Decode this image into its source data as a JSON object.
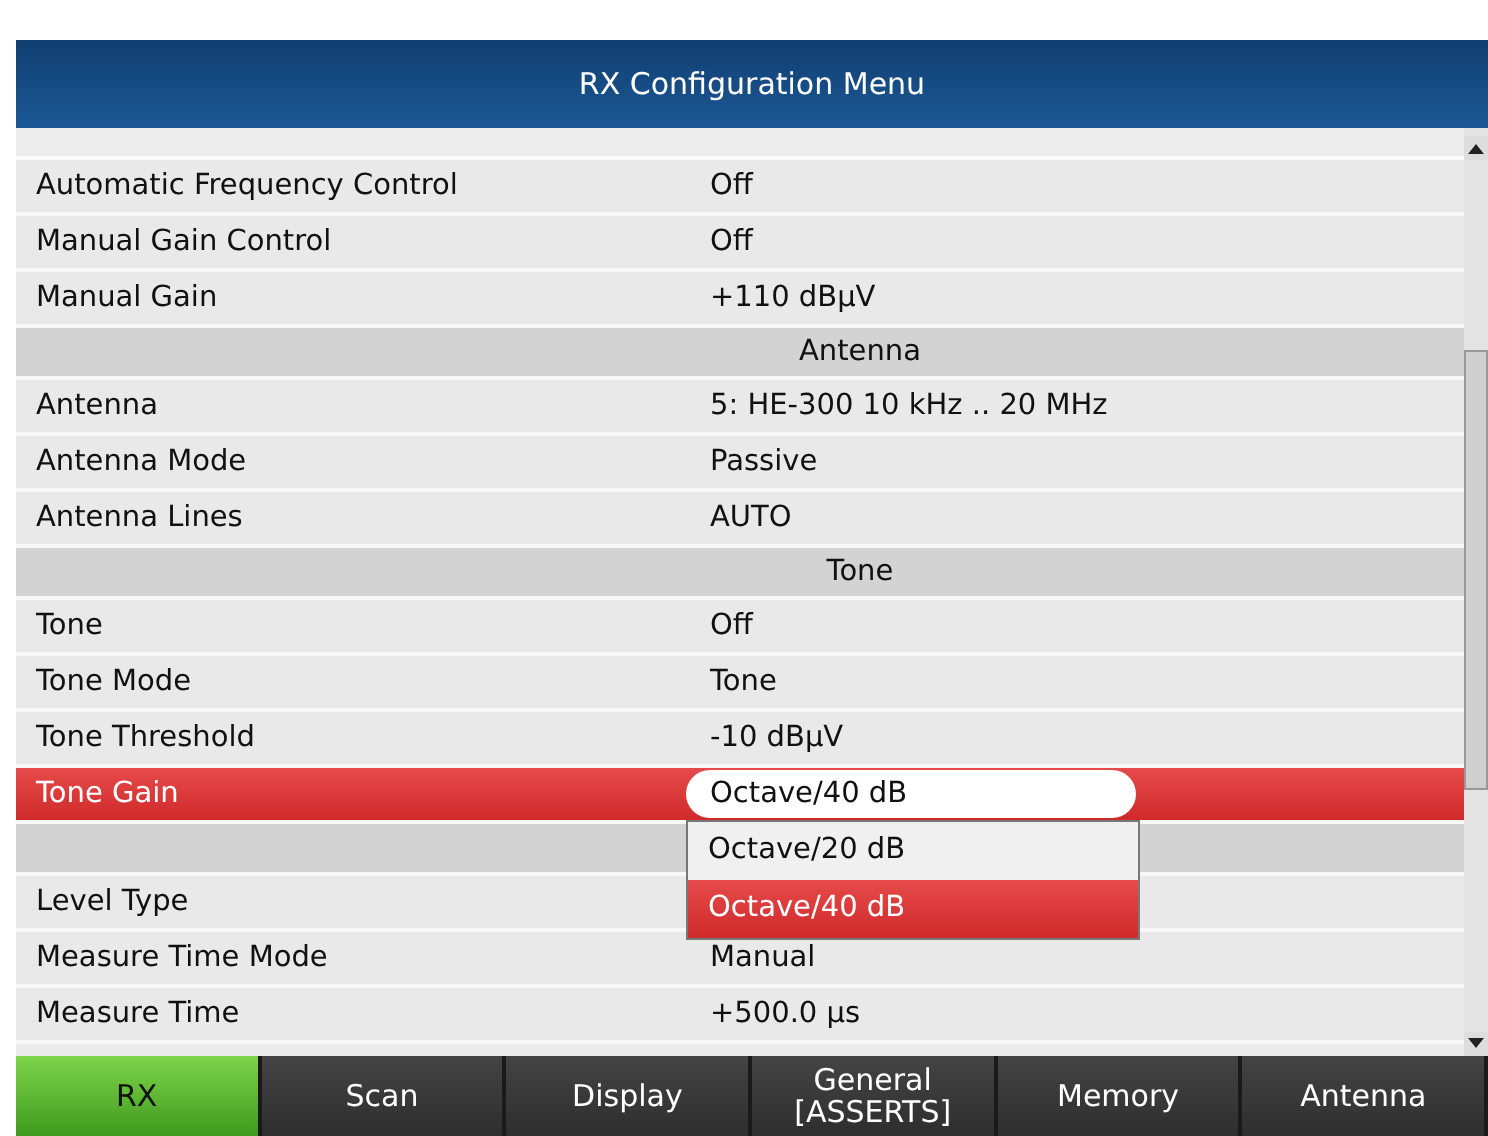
{
  "window": {
    "title": "RX Configuration Menu"
  },
  "rows": [
    {
      "kind": "item",
      "name": "Automatic Frequency Control",
      "value": "Off",
      "selected": false
    },
    {
      "kind": "item",
      "name": "Manual Gain Control",
      "value": "Off",
      "selected": false
    },
    {
      "kind": "item",
      "name": "Manual Gain",
      "value": "+110 dBµV",
      "selected": false
    },
    {
      "kind": "header",
      "label": "Antenna"
    },
    {
      "kind": "item",
      "name": "Antenna",
      "value": "5: HE-300 10 kHz .. 20 MHz",
      "selected": false
    },
    {
      "kind": "item",
      "name": "Antenna Mode",
      "value": "Passive",
      "selected": false
    },
    {
      "kind": "item",
      "name": "Antenna Lines",
      "value": "AUTO",
      "selected": false
    },
    {
      "kind": "header",
      "label": "Tone"
    },
    {
      "kind": "item",
      "name": "Tone",
      "value": "Off",
      "selected": false
    },
    {
      "kind": "item",
      "name": "Tone Mode",
      "value": "Tone",
      "selected": false
    },
    {
      "kind": "item",
      "name": "Tone Threshold",
      "value": "-10 dBµV",
      "selected": false
    },
    {
      "kind": "item",
      "name": "Tone Gain",
      "value": "Octave/40 dB",
      "selected": true,
      "options": [
        {
          "label": "Octave/20 dB",
          "selected": false
        },
        {
          "label": "Octave/40 dB",
          "selected": true
        }
      ]
    },
    {
      "kind": "header"
    },
    {
      "kind": "item",
      "name": "Level Type",
      "selected": false
    },
    {
      "kind": "item",
      "name": "Measure Time Mode",
      "value": "Manual",
      "selected": false
    },
    {
      "kind": "item",
      "name": "Measure Time",
      "value": "+500.0 µs",
      "selected": false
    }
  ],
  "softkeys": [
    {
      "label": "RX",
      "selected": true
    },
    {
      "label": "Scan",
      "selected": false
    },
    {
      "label": "Display",
      "selected": false
    },
    {
      "label": "General\n[ASSERTS]",
      "selected": false
    },
    {
      "label": "Memory",
      "selected": false
    },
    {
      "label": "Antenna",
      "selected": false
    }
  ]
}
